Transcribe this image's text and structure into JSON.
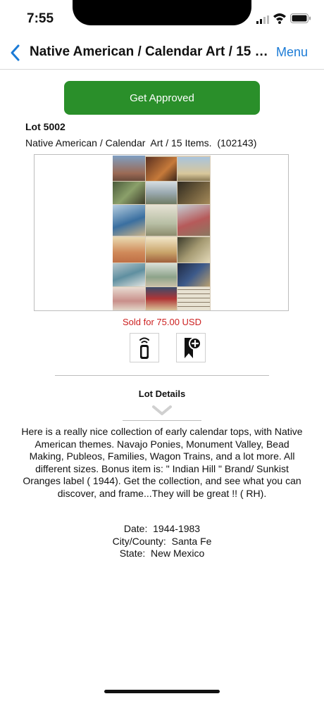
{
  "status_bar": {
    "time": "7:55"
  },
  "nav": {
    "title": "Native American / Calendar  Art / 15 I...",
    "menu_label": "Menu",
    "back_icon": "chevron-left-icon",
    "accent_color": "#1b7bd6"
  },
  "actions": {
    "approve_label": "Get Approved",
    "approve_color": "#2a8f2a"
  },
  "lot": {
    "number": "Lot 5002",
    "title": "Native American / Calendar  Art / 15 Items.  (102143)",
    "sold_text": "Sold for 75.00 USD",
    "sold_color": "#cc1f1f"
  },
  "icons": {
    "remote": "remote-control-icon",
    "watch": "bookmark-add-icon"
  },
  "details": {
    "heading": "Lot Details",
    "description": "Here is a really nice collection of early calendar tops, with Native American themes. Navajo Ponies, Monument Valley, Bead Making, Publeos, Families, Wagon Trains, and a lot more. All different sizes. Bonus item is:  \" Indian Hill \" Brand/ Sunkist Oranges label ( 1944). Get the collection, and see what you can discover, and frame...They will be great !! ( RH).",
    "date": "Date:  1944-1983",
    "location": "City/County:  Santa Fe",
    "state": "State:  New Mexico"
  }
}
